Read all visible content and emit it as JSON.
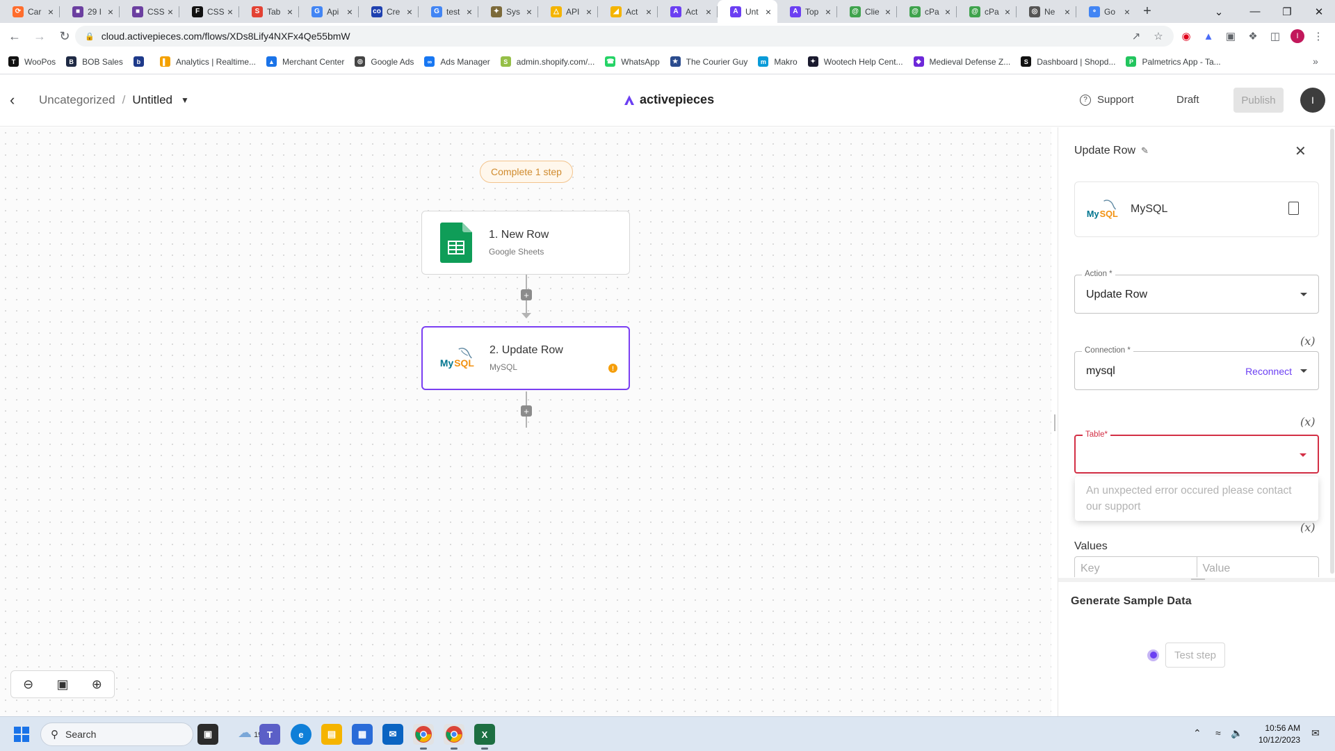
{
  "browser": {
    "tabs": [
      {
        "label": "Car",
        "color": "#ff6d2d",
        "glyph": "⟳"
      },
      {
        "label": "29 I",
        "color": "#6b3fa0",
        "glyph": "■"
      },
      {
        "label": "CSS",
        "color": "#6b3fa0",
        "glyph": "■"
      },
      {
        "label": "CSS",
        "color": "#111111",
        "glyph": "F"
      },
      {
        "label": "Tab",
        "color": "#e34234",
        "glyph": "S"
      },
      {
        "label": "Api",
        "color": "#4285f4",
        "glyph": "G"
      },
      {
        "label": "Cre",
        "color": "#1e40af",
        "glyph": "co"
      },
      {
        "label": "test",
        "color": "#4285f4",
        "glyph": "G"
      },
      {
        "label": "Sys",
        "color": "#7c6a3a",
        "glyph": "✦"
      },
      {
        "label": "API",
        "color": "#f4b400",
        "glyph": "△"
      },
      {
        "label": "Act",
        "color": "#f4b400",
        "glyph": "◢"
      },
      {
        "label": "Act",
        "color": "#6b3ff2",
        "glyph": "A"
      },
      {
        "label": "Unt",
        "color": "#6b3ff2",
        "glyph": "A",
        "active": true
      },
      {
        "label": "Top",
        "color": "#6b3ff2",
        "glyph": "A"
      },
      {
        "label": "Clie",
        "color": "#3fa34d",
        "glyph": "@"
      },
      {
        "label": "cPa",
        "color": "#3fa34d",
        "glyph": "@"
      },
      {
        "label": "cPa",
        "color": "#3fa34d",
        "glyph": "@"
      },
      {
        "label": "Ne",
        "color": "#555555",
        "glyph": "◎"
      },
      {
        "label": "Go",
        "color": "#4285f4",
        "glyph": "∘"
      }
    ],
    "url": "cloud.activepieces.com/flows/XDs8Lify4NXFx4Qe55bmW",
    "bookmarks": [
      {
        "label": "WooPos",
        "color": "#111111",
        "glyph": "T"
      },
      {
        "label": "BOB Sales",
        "color": "#1f2a44",
        "glyph": "B"
      },
      {
        "label": "",
        "color": "#1e3a8a",
        "glyph": "b"
      },
      {
        "label": "Analytics | Realtime...",
        "color": "#f4a100",
        "glyph": "▌"
      },
      {
        "label": "Merchant Center",
        "color": "#1a73e8",
        "glyph": "▲"
      },
      {
        "label": "Google Ads",
        "color": "#444444",
        "glyph": "◎"
      },
      {
        "label": "Ads Manager",
        "color": "#1877f2",
        "glyph": "∞"
      },
      {
        "label": "admin.shopify.com/...",
        "color": "#95bf47",
        "glyph": "S"
      },
      {
        "label": "WhatsApp",
        "color": "#25d366",
        "glyph": "☎"
      },
      {
        "label": "The Courier Guy",
        "color": "#2a4b8d",
        "glyph": "★"
      },
      {
        "label": "Makro",
        "color": "#0a9bd8",
        "glyph": "m"
      },
      {
        "label": "Wootech Help Cent...",
        "color": "#1a1a2e",
        "glyph": "✦"
      },
      {
        "label": "Medieval Defense Z...",
        "color": "#6d28d9",
        "glyph": "◆"
      },
      {
        "label": "Dashboard | Shopd...",
        "color": "#111111",
        "glyph": "S"
      },
      {
        "label": "Palmetrics App - Ta...",
        "color": "#22c55e",
        "glyph": "P"
      }
    ]
  },
  "header": {
    "breadcrumb_folder": "Uncategorized",
    "breadcrumb_separator": "/",
    "flow_name": "Untitled",
    "logo_text": "activepieces",
    "support_label": "Support",
    "draft_label": "Draft",
    "publish_label": "Publish",
    "avatar_initial": "I"
  },
  "canvas": {
    "status_pill": "Complete 1 step",
    "steps": [
      {
        "title": "1. New Row",
        "subtitle": "Google Sheets",
        "icon": "google-sheets-icon",
        "selected": false,
        "warning": false
      },
      {
        "title": "2. Update Row",
        "subtitle": "MySQL",
        "icon": "mysql-icon",
        "selected": true,
        "warning": true
      }
    ],
    "zoom_controls": [
      "zoom-out-icon",
      "fit-view-icon",
      "zoom-in-icon"
    ]
  },
  "panel": {
    "title": "Update Row",
    "piece_name": "MySQL",
    "action": {
      "label": "Action *",
      "value": "Update Row"
    },
    "connection": {
      "label": "Connection *",
      "value": "mysql",
      "reconnect_label": "Reconnect"
    },
    "table": {
      "label": "Table*",
      "value": ""
    },
    "table_error": "An unxpected error occured please contact our support",
    "fx_label": "(x)",
    "values_label": "Values",
    "key_placeholder": "Key",
    "value_placeholder": "Value",
    "generate_title": "Generate Sample Data",
    "test_button": "Test step"
  },
  "taskbar": {
    "search_label": "Search",
    "weather": "19°",
    "time": "10:56 AM",
    "date": "10/12/2023"
  },
  "colors": {
    "brand": "#6b3ff2",
    "error": "#d32f45",
    "warning": "#f59e0b",
    "pill_text": "#d08b2e"
  }
}
